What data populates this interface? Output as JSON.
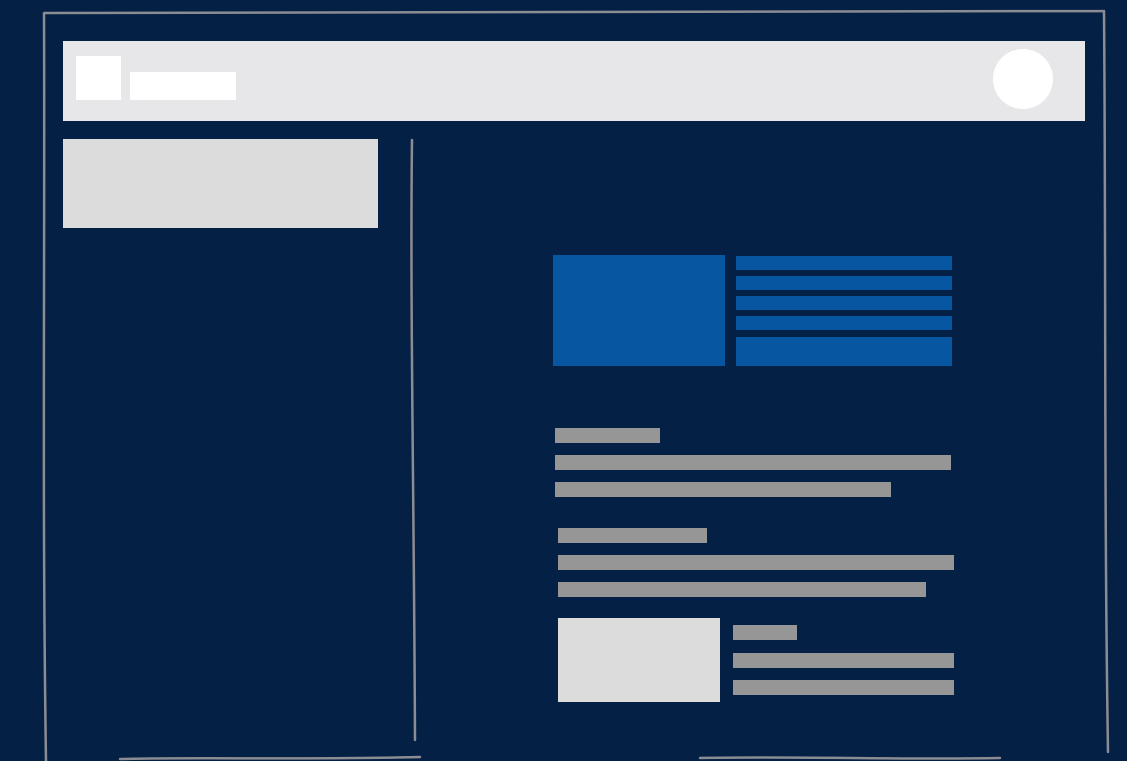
{
  "colors": {
    "background": "#042044",
    "frame_line": "#8c8c94",
    "header_bar": "#e7e7ea",
    "white": "#ffffff",
    "panel_light": "#dcdcdd",
    "accent_blue": "#0656a2",
    "text_placeholder": "#969696"
  },
  "icons": {
    "logo": "logo-placeholder-icon",
    "avatar": "user-avatar-icon",
    "hero_image": "image-placeholder-icon",
    "card_thumbnail": "image-placeholder-icon"
  }
}
